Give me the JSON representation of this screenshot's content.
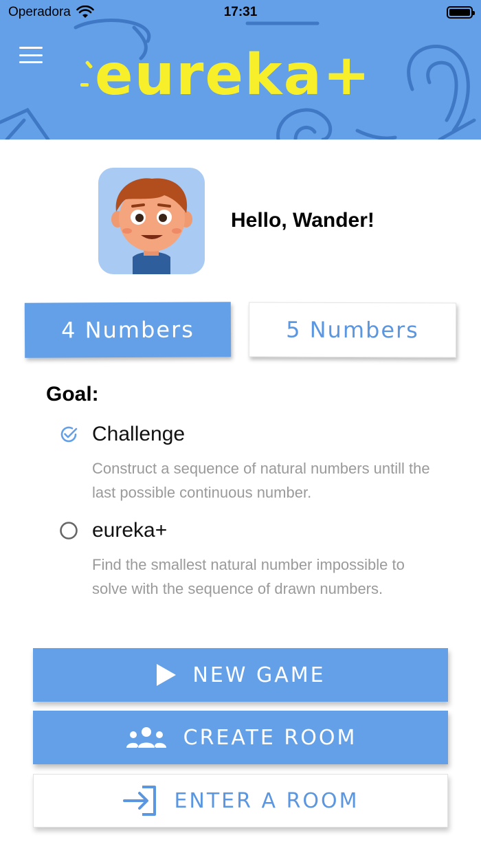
{
  "status_bar": {
    "carrier": "Operadora",
    "time": "17:31"
  },
  "header": {
    "logo_text": "eureka+"
  },
  "profile": {
    "greeting": "Hello, Wander!"
  },
  "tabs": [
    {
      "label": "4 Numbers",
      "active": true
    },
    {
      "label": "5 Numbers",
      "active": false
    }
  ],
  "goal": {
    "title": "Goal:",
    "options": [
      {
        "label": "Challenge",
        "selected": true,
        "description": "Construct a sequence of natural numbers untill the last possible continuous number."
      },
      {
        "label": "eureka+",
        "selected": false,
        "description": "Find the smallest natural number impossible to solve with the sequence of drawn numbers."
      }
    ]
  },
  "actions": {
    "new_game": "NEW GAME",
    "create_room": "CREATE ROOM",
    "enter_room": "ENTER A ROOM"
  },
  "colors": {
    "primary": "#64a0e8",
    "logo_yellow": "#f6ef2a",
    "muted_text": "#9a9a9a"
  },
  "icons": {
    "menu": "hamburger-icon",
    "wifi": "wifi-icon",
    "battery": "battery-icon",
    "checked": "check-circle-icon",
    "unchecked": "radio-empty-icon",
    "play": "play-icon",
    "group": "group-icon",
    "enter": "login-icon"
  }
}
